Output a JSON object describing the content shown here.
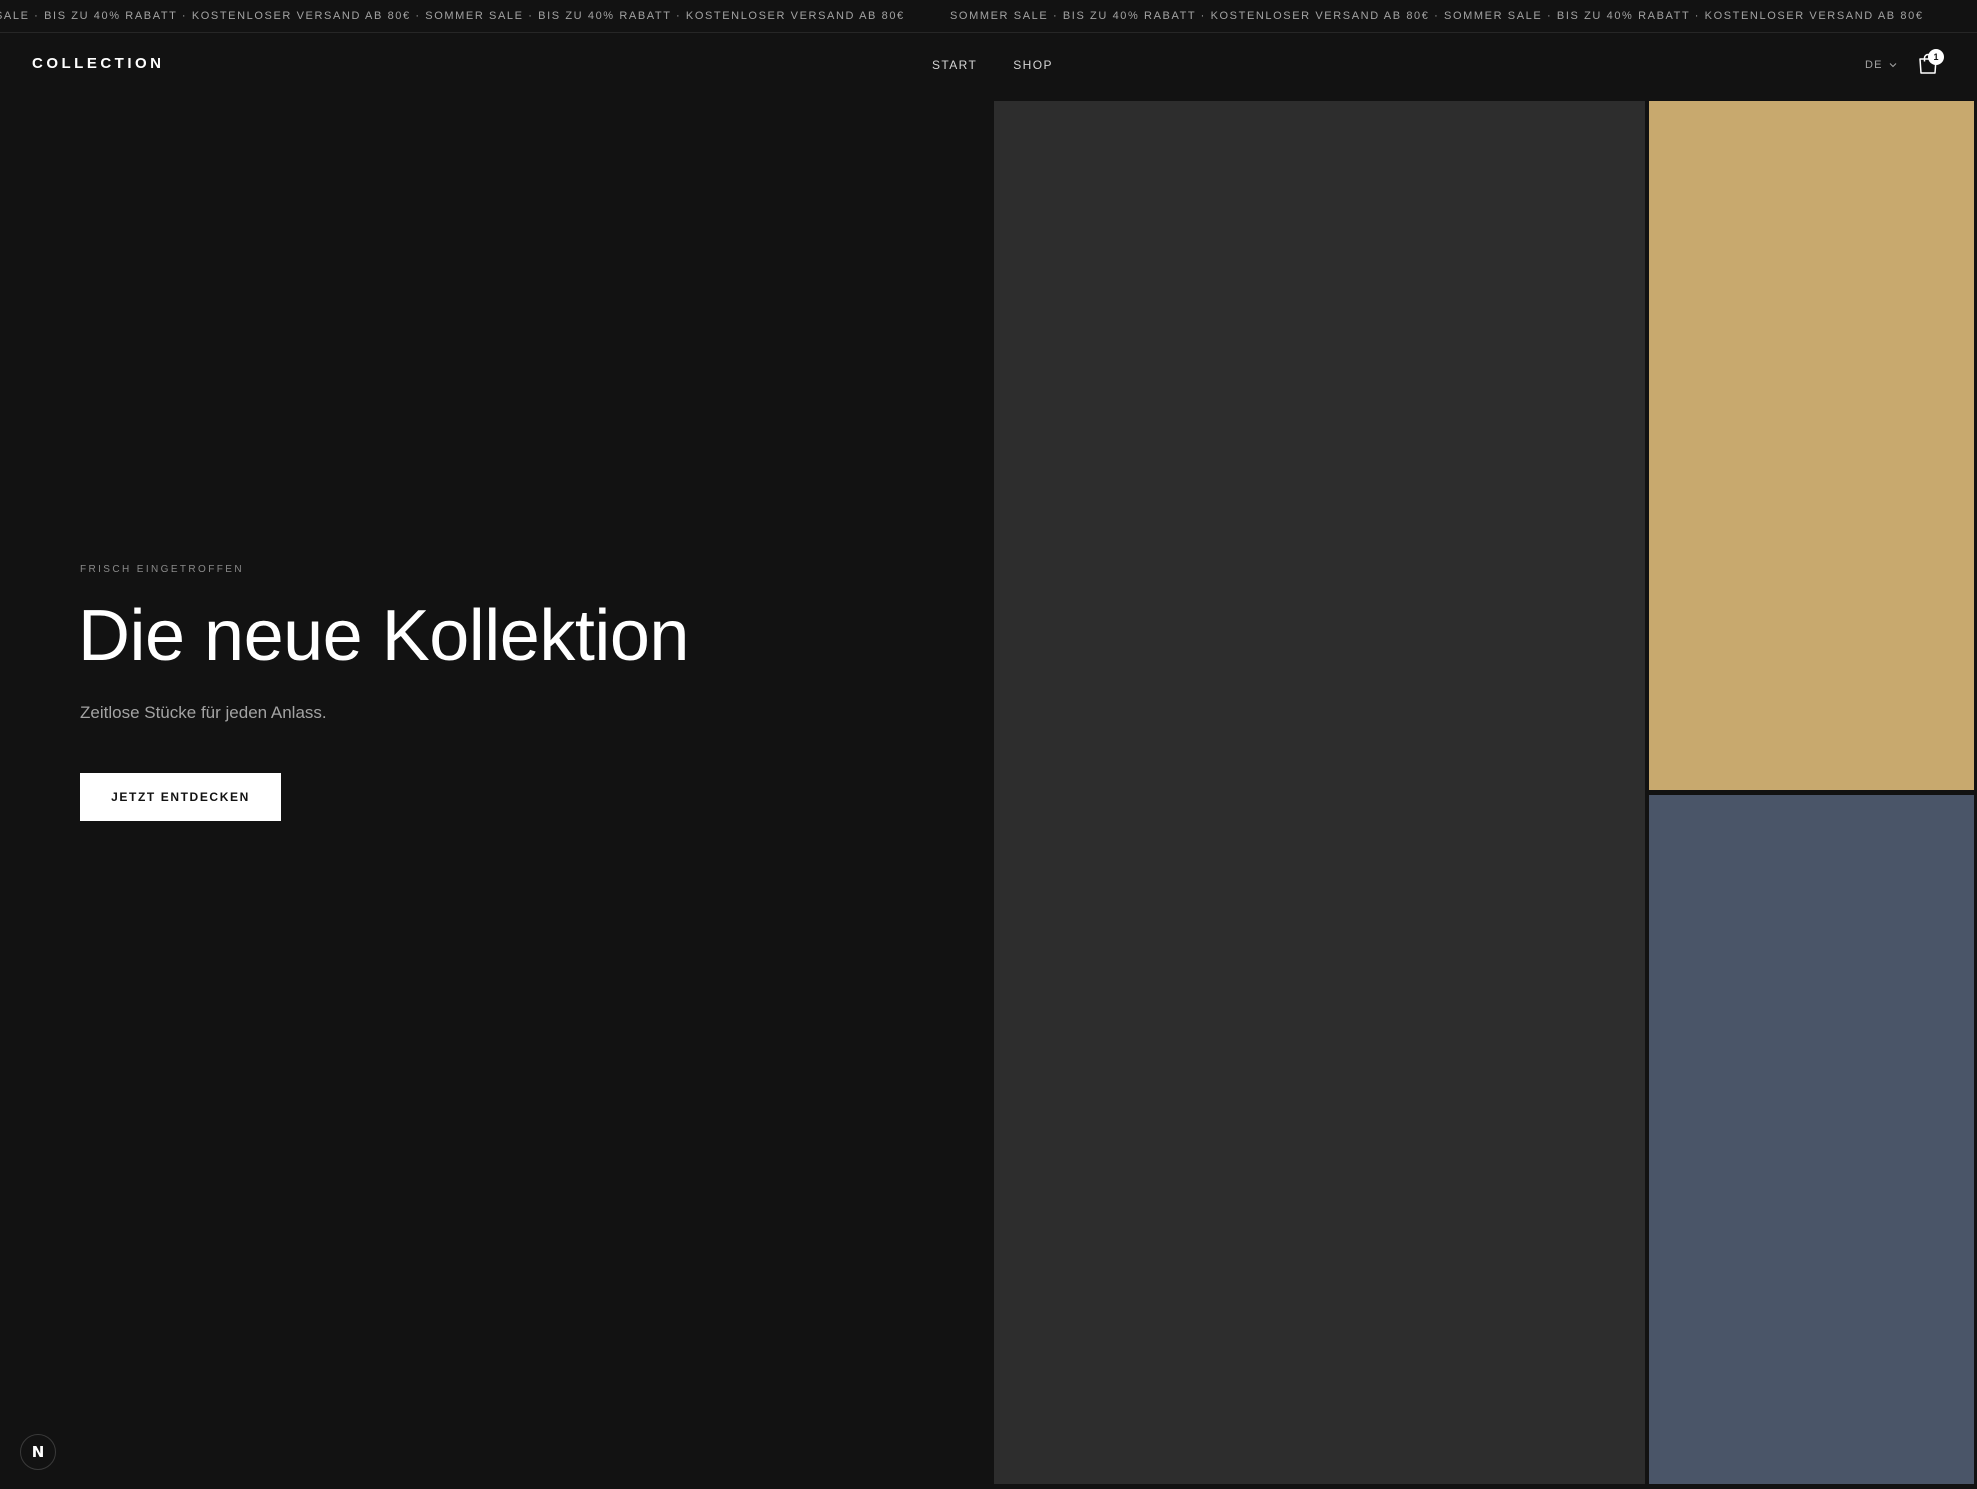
{
  "announcement": {
    "text_a": "SALE · BIS ZU 40% RABATT · KOSTENLOSER VERSAND AB 80€ · SOMMER SALE · BIS ZU 40% RABATT · KOSTENLOSER VERSAND AB 80€",
    "text_b": "SOMMER SALE · BIS ZU 40% RABATT · KOSTENLOSER VERSAND AB 80€ · SOMMER SALE · BIS ZU 40% RABATT · KOSTENLOSER VERSAND AB 80€"
  },
  "header": {
    "logo": "COLLECTION",
    "nav": [
      {
        "label": "START"
      },
      {
        "label": "SHOP"
      }
    ],
    "language": "DE",
    "cart_count": "1",
    "icons": {
      "cart": "shopping-bag-icon",
      "language": "chevron-down-icon"
    }
  },
  "hero": {
    "eyebrow": "FRISCH EINGETROFFEN",
    "title": "Die neue Kollektion",
    "subtitle": "Zeitlose Stücke für jeden Anlass.",
    "cta_label": "JETZT ENTDECKEN"
  },
  "panels": {
    "main_color": "#2d2d2d",
    "gold_color": "#c8a96e",
    "slate_color": "#4a5568"
  },
  "dev_badge": {
    "label": "N"
  },
  "colors": {
    "background": "#121212",
    "text": "#ffffff",
    "muted": "#a3a3a3"
  }
}
